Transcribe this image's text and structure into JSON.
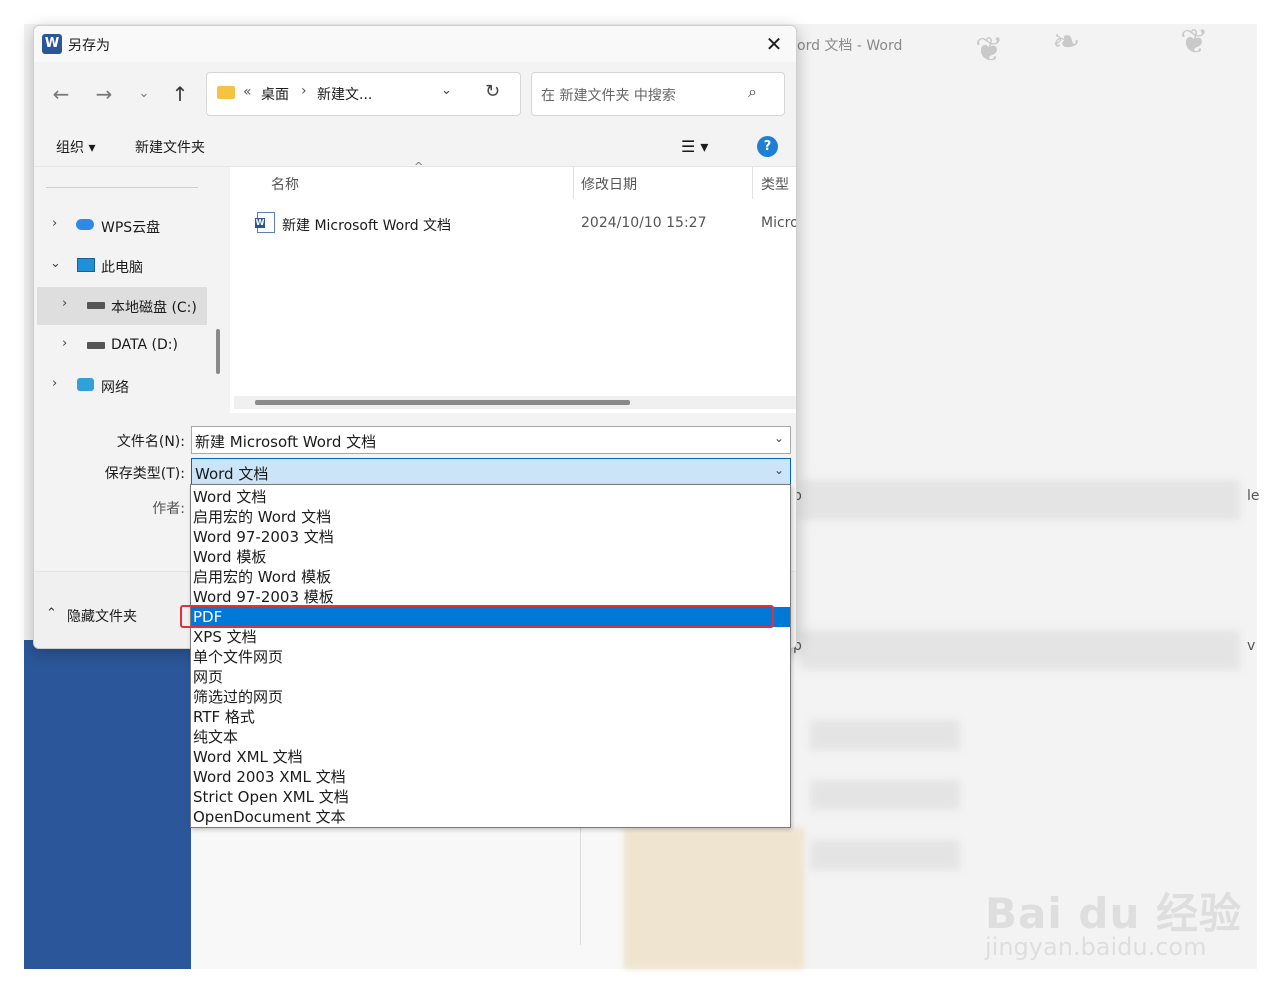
{
  "background": {
    "title": "ord 文档 - Word",
    "fragments": [
      "p",
      "le",
      "p",
      "v"
    ]
  },
  "dialog": {
    "title": "另存为",
    "close_glyph": "✕",
    "address": {
      "root": "«",
      "crumb1": "桌面",
      "sep": "›",
      "crumb2": "新建文..."
    },
    "search_placeholder": "在 新建文件夹 中搜索",
    "toolbar": {
      "organize": "组织 ▾",
      "new_folder": "新建文件夹",
      "help": "?"
    },
    "nav": [
      {
        "label": "WPS云盘",
        "chev": "›"
      },
      {
        "label": "此电脑",
        "chev": "⌄"
      },
      {
        "label": "本地磁盘 (C:)",
        "chev": "›"
      },
      {
        "label": "DATA (D:)",
        "chev": "›"
      },
      {
        "label": "网络",
        "chev": "›"
      }
    ],
    "columns": {
      "name": "名称",
      "date": "修改日期",
      "type": "类型"
    },
    "files": [
      {
        "name": "新建 Microsoft Word 文档",
        "date": "2024/10/10 15:27",
        "type": "Micro"
      }
    ],
    "form": {
      "filename_label": "文件名(N):",
      "filename_value": "新建 Microsoft Word 文档",
      "filetype_label": "保存类型(T):",
      "filetype_value": "Word 文档",
      "author_label": "作者:"
    },
    "hide_folders": "隐藏文件夹"
  },
  "filetype_options": [
    "Word 文档",
    "启用宏的 Word 文档",
    "Word 97-2003 文档",
    "Word 模板",
    "启用宏的 Word 模板",
    "Word 97-2003 模板",
    "PDF",
    "XPS 文档",
    "单个文件网页",
    "网页",
    "筛选过的网页",
    "RTF 格式",
    "纯文本",
    "Word XML 文档",
    "Word 2003 XML 文档",
    "Strict Open XML 文档",
    "OpenDocument 文本"
  ],
  "selected_option": "PDF",
  "watermark": {
    "line1": "Bai du 经验",
    "line2": "jingyan.baidu.com"
  },
  "colors": {
    "accent": "#0078d7",
    "word_blue": "#2b579a",
    "highlight_red": "#e0303c"
  }
}
